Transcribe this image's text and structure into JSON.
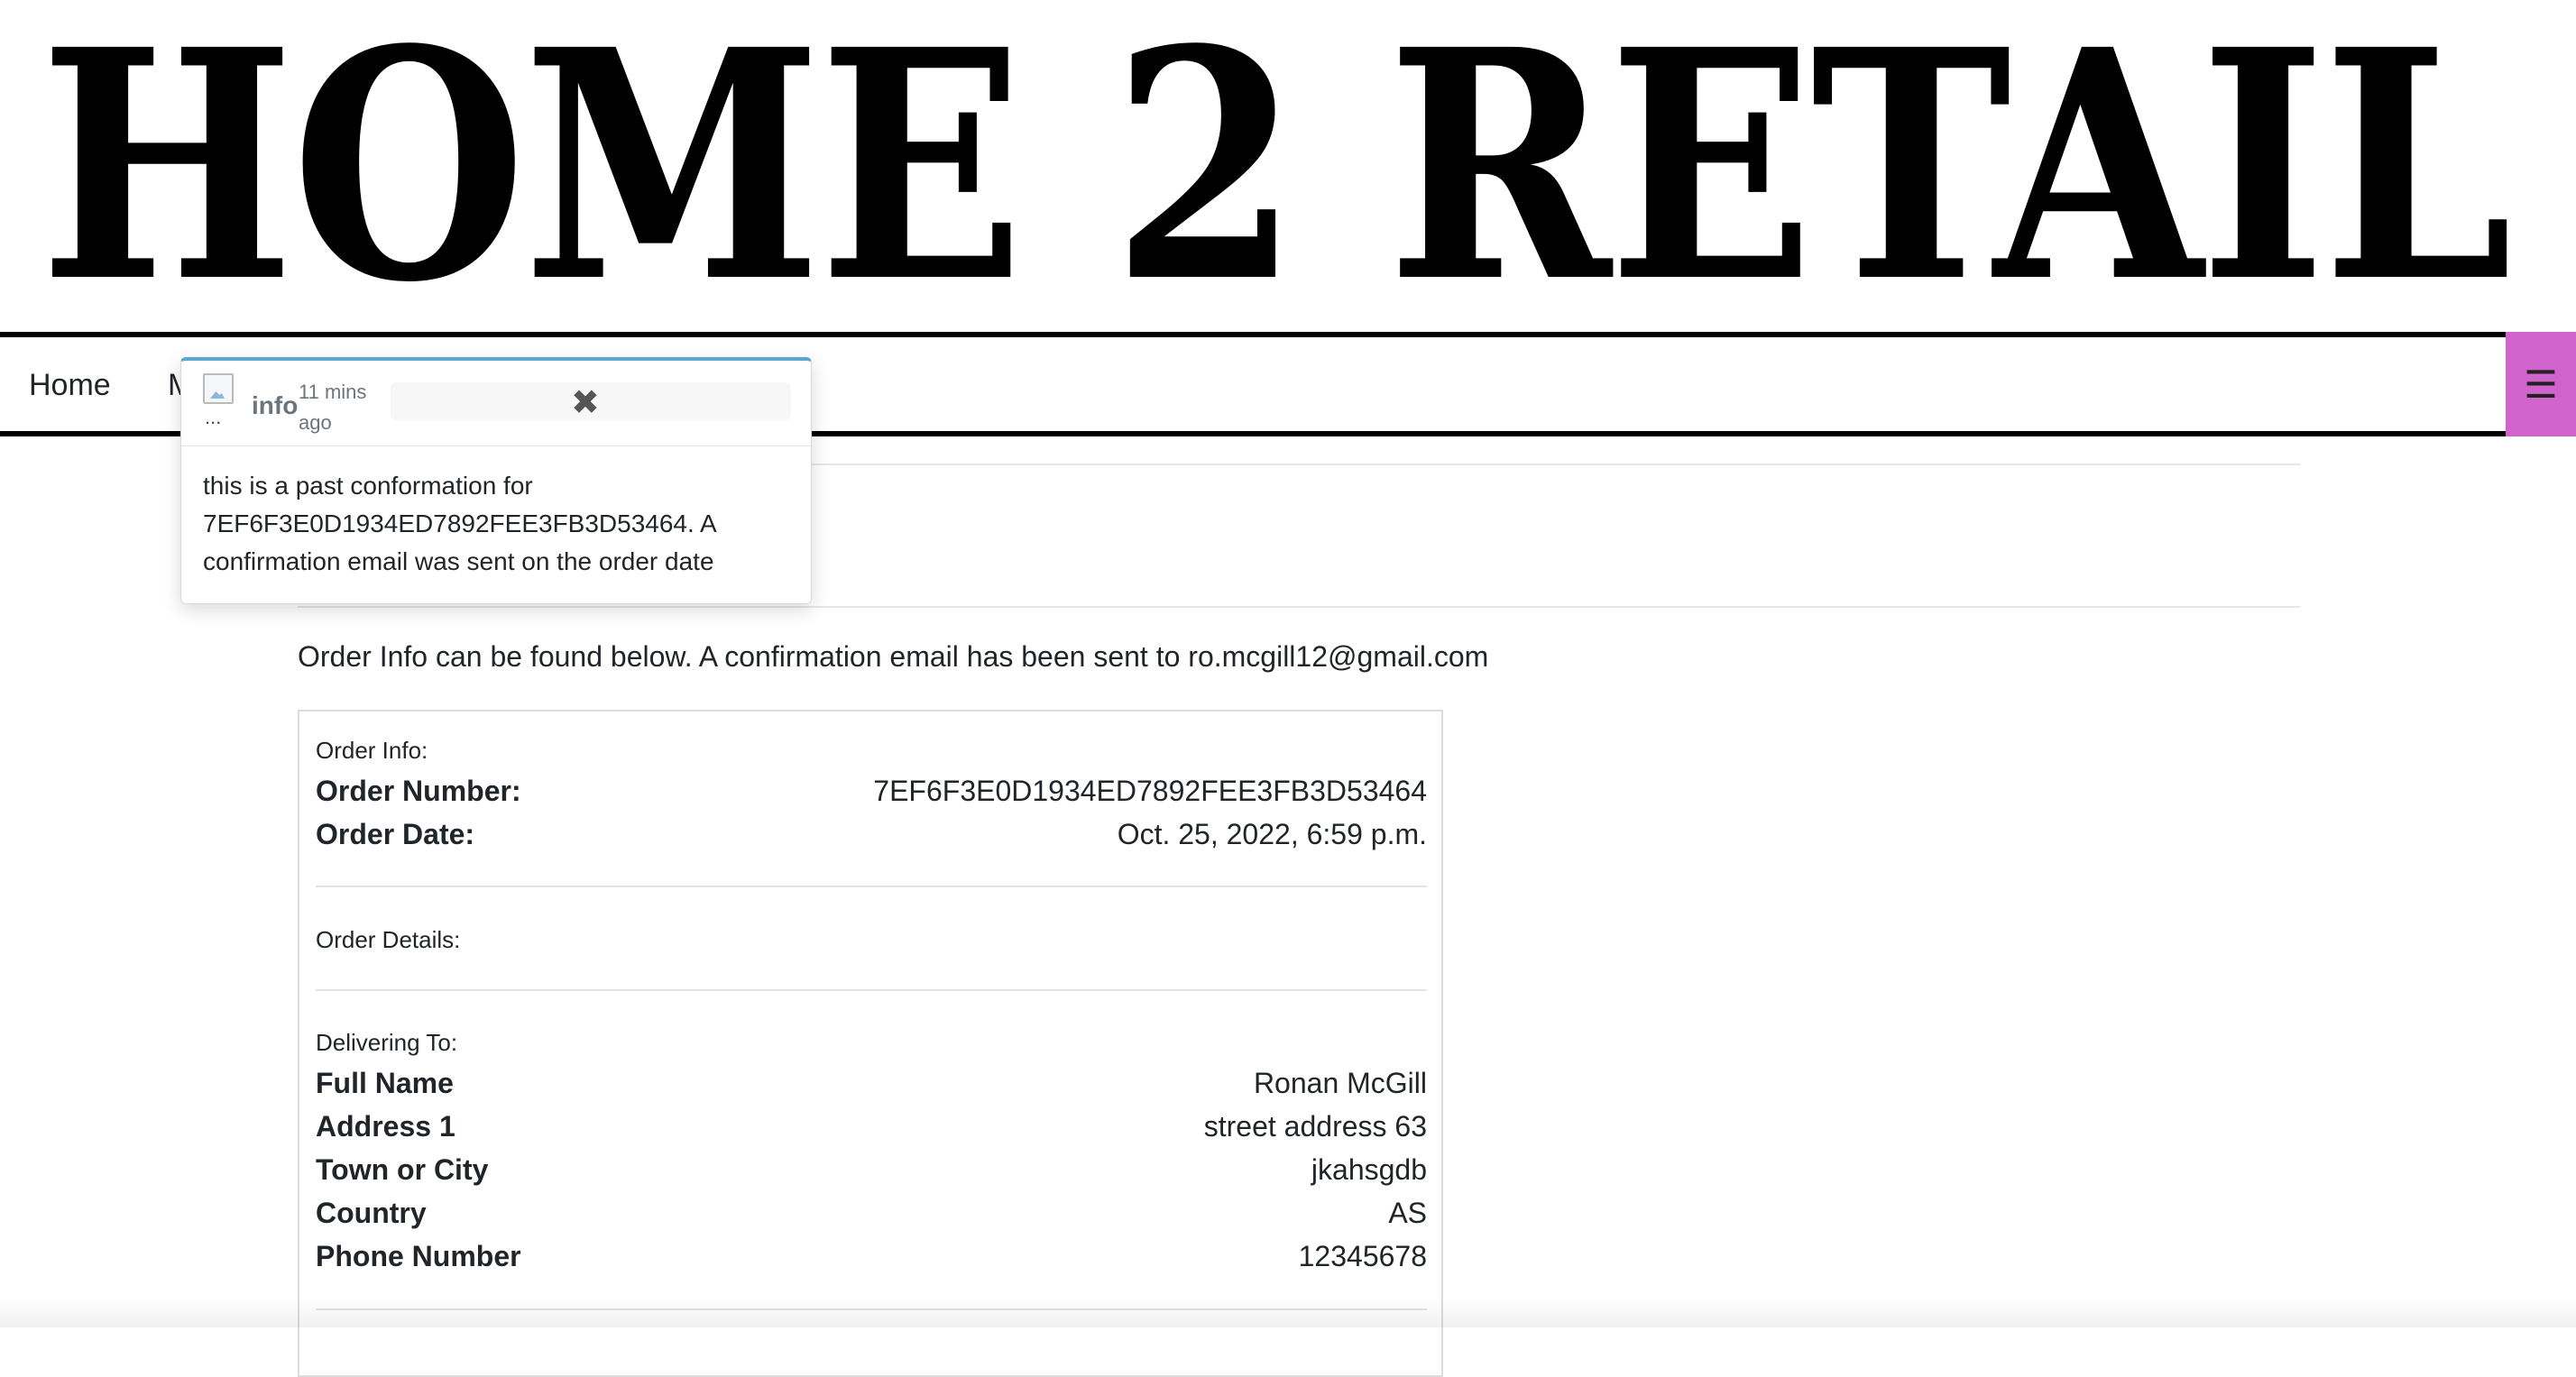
{
  "header": {
    "logo_text": "HOME 2 RETAIL"
  },
  "nav": {
    "home_label": "Home",
    "second_label_visible": "M",
    "menu_icon": "hamburger-icon",
    "menu_toggle_color": "#d063cc"
  },
  "toast": {
    "image_alt": "...",
    "title": "info",
    "time": "11 mins ago",
    "close_glyph": "✖",
    "message": "this is a past conformation for 7EF6F3E0D1934ED7892FEE3FB3D53464. A confirmation email was sent on the order date",
    "accent_color": "#5aa6cc"
  },
  "main": {
    "intro": "Order Info can be found below. A confirmation email has been sent to ro.mcgill12@gmail.com"
  },
  "order_info": {
    "section_label": "Order Info:",
    "order_number_label": "Order Number:",
    "order_number": "7EF6F3E0D1934ED7892FEE3FB3D53464",
    "order_date_label": "Order Date:",
    "order_date": "Oct. 25, 2022, 6:59 p.m."
  },
  "order_details": {
    "section_label": "Order Details:"
  },
  "delivery": {
    "section_label": "Delivering To:",
    "rows": [
      {
        "label": "Full Name",
        "value": "Ronan McGill"
      },
      {
        "label": "Address 1",
        "value": "street address 63"
      },
      {
        "label": "Town or City",
        "value": "jkahsgdb"
      },
      {
        "label": "Country",
        "value": "AS"
      },
      {
        "label": "Phone Number",
        "value": "12345678"
      }
    ]
  }
}
